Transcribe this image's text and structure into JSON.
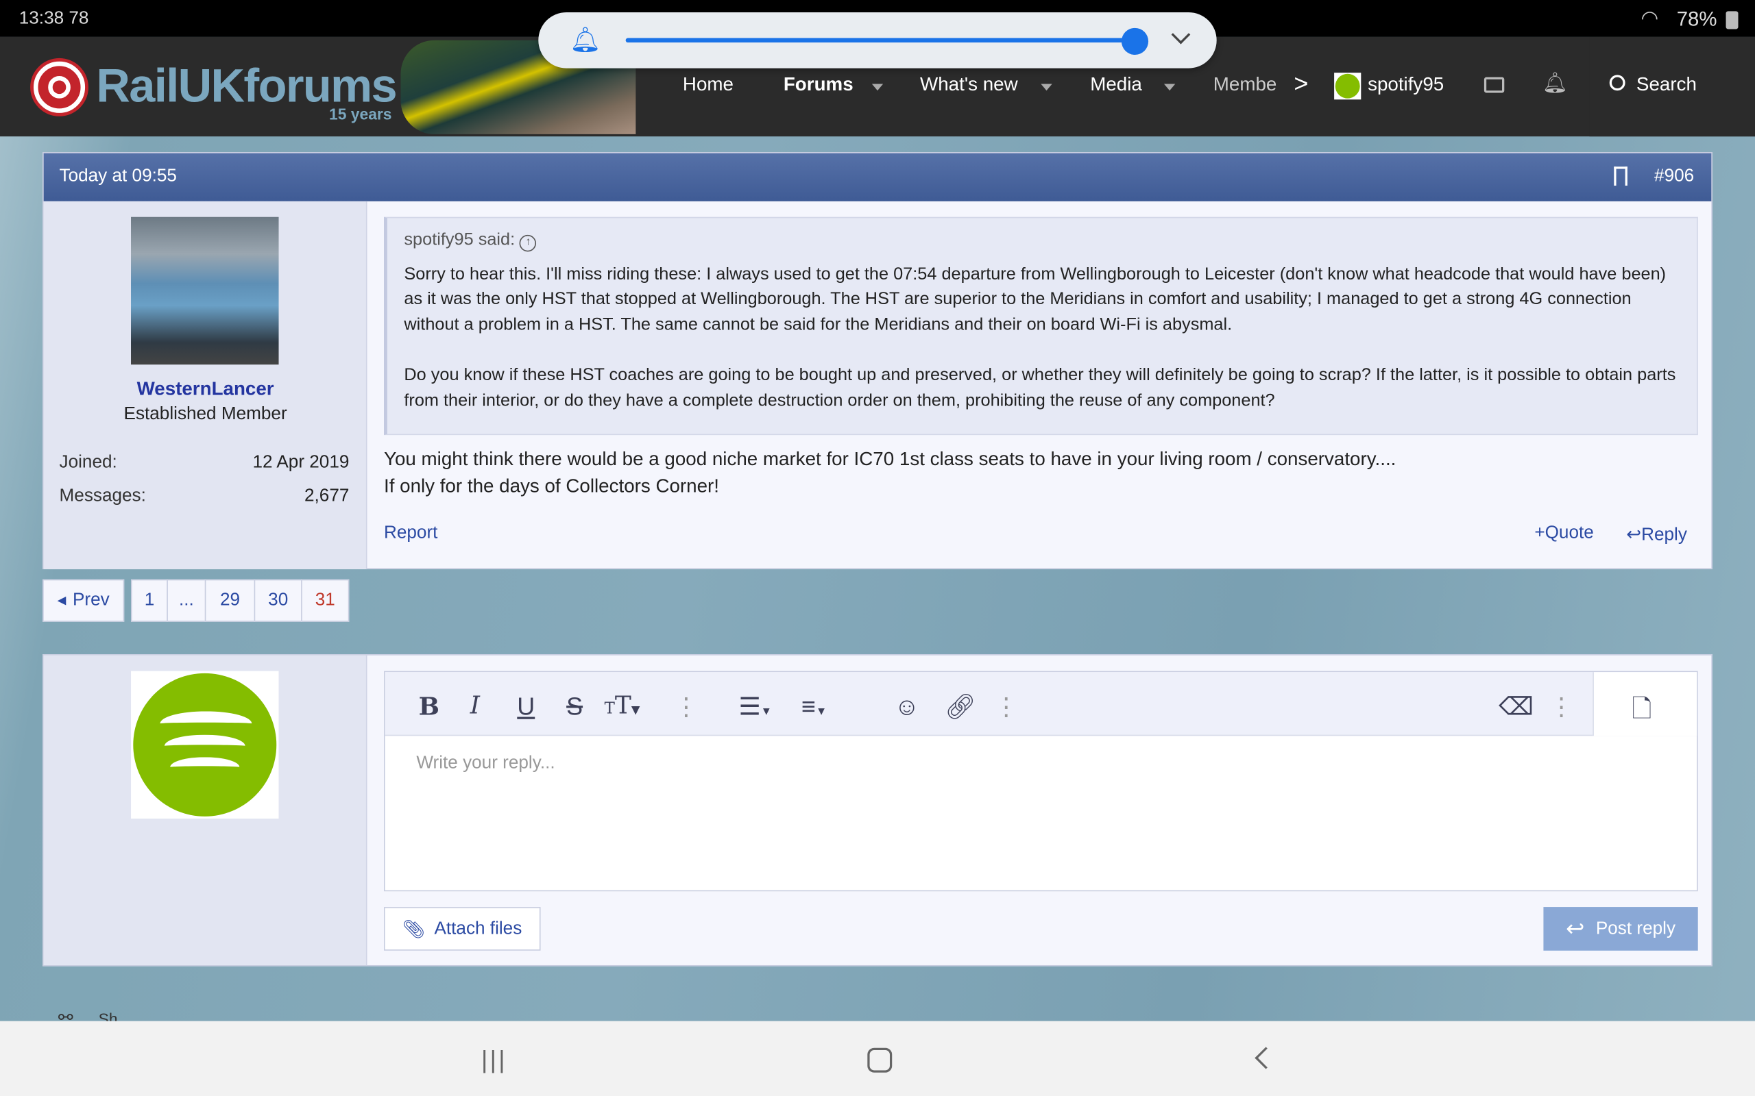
{
  "status_bar": {
    "time": "13:38 78",
    "battery": "78%"
  },
  "volume_panel": {
    "level": 0.95,
    "accent": "#1a73e8"
  },
  "header": {
    "logo": "RailUKforums",
    "logo_sub": "15 years",
    "nav": [
      {
        "label": "Home"
      },
      {
        "label": "Forums"
      },
      {
        "label": "What's new"
      },
      {
        "label": "Media"
      },
      {
        "label": "Membe"
      }
    ],
    "username": "spotify95",
    "search_label": "Search"
  },
  "post": {
    "timestamp": "Today at 09:55",
    "number": "#906",
    "author": {
      "name": "WesternLancer",
      "title": "Established Member",
      "joined_label": "Joined:",
      "joined": "12 Apr 2019",
      "messages_label": "Messages:",
      "messages": "2,677"
    },
    "quote": {
      "author": "spotify95 said:",
      "p1": "Sorry to hear this. I'll miss riding these: I always used to get the 07:54 departure from Wellingborough to Leicester (don't know what headcode that would have been) as it was the only HST that stopped at Wellingborough. The HST are superior to the Meridians in comfort and usability; I managed to get a strong 4G connection without a problem in a HST. The same cannot be said for the Meridians and their on board Wi-Fi is abysmal.",
      "p2": "Do you know if these HST coaches are going to be bought up and preserved, or whether they will definitely be going to scrap? If the latter, is it possible to obtain parts from their interior, or do they have a complete destruction order on them, prohibiting the reuse of any component?"
    },
    "body_line1": "You might think there would be a good niche market for IC70 1st class seats to have in your living room / conservatory....",
    "body_line2": "If only for the days of Collectors Corner!",
    "report": "Report",
    "quote_btn": "Quote",
    "reply_btn": "Reply"
  },
  "pagination": {
    "prev": "Prev",
    "pages": [
      "1",
      "...",
      "29",
      "30",
      "31"
    ],
    "current": "31"
  },
  "reply_box": {
    "placeholder": "Write your reply...",
    "attach": "Attach files",
    "post": "Post reply"
  },
  "share": {
    "label": "Sh"
  },
  "colors": {
    "header": "#2b2b2b",
    "post_head": "#4a66a0",
    "link": "#2b4aa3",
    "current_page": "#c0392b",
    "post_reply_btn": "#8aa8d6"
  }
}
